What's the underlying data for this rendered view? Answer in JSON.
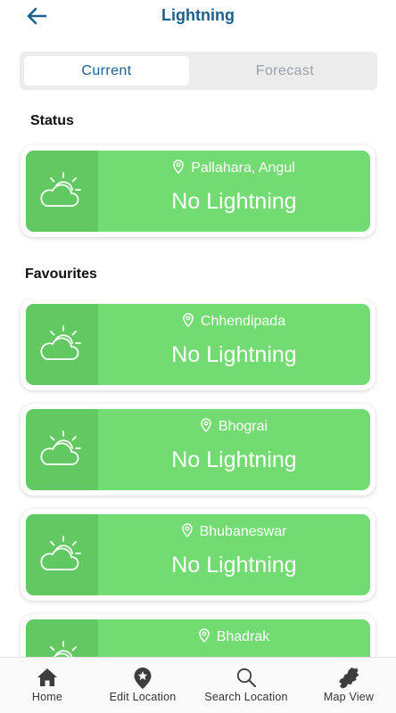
{
  "header": {
    "title": "Lightning",
    "back_icon": "arrow-left-icon"
  },
  "tabs": [
    {
      "label": "Current",
      "selected": true
    },
    {
      "label": "Forecast",
      "selected": false
    }
  ],
  "status_section": {
    "label": "Status",
    "card": {
      "icon": "sun-cloud-icon",
      "location": "Pallahara, Angul",
      "status": "No Lightning"
    }
  },
  "favourites_section": {
    "label": "Favourites",
    "cards": [
      {
        "icon": "sun-cloud-icon",
        "location": "Chhendipada",
        "status": "No Lightning"
      },
      {
        "icon": "sun-cloud-icon",
        "location": "Bhograi",
        "status": "No Lightning"
      },
      {
        "icon": "sun-cloud-icon",
        "location": "Bhubaneswar",
        "status": "No Lightning"
      },
      {
        "icon": "sun-cloud-icon",
        "location": "Bhadrak",
        "status": ""
      }
    ]
  },
  "bottom_nav": [
    {
      "label": "Home",
      "icon": "home-icon"
    },
    {
      "label": "Edit Location",
      "icon": "map-pin-star-icon"
    },
    {
      "label": "Search Location",
      "icon": "search-icon"
    },
    {
      "label": "Map View",
      "icon": "state-map-icon"
    }
  ],
  "colors": {
    "accent": "#1c5f8f",
    "card_green": "#72db72",
    "card_icon_panel": "#62c862",
    "tab_background": "#ececec"
  }
}
